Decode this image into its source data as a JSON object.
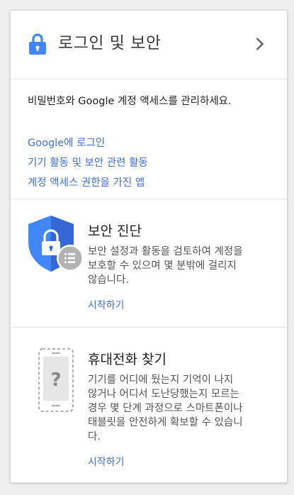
{
  "header": {
    "title": "로그인 및 보안"
  },
  "intro": {
    "description": "비밀번호와 Google 계정 액세스를 관리하세요.",
    "links": [
      "Google에 로그인",
      "기기 활동 및 보안 관련 활동",
      "계정 액세스 권한을 가진 앱"
    ]
  },
  "security_checkup": {
    "title": "보안 진단",
    "body_lines": [
      "보안 설정과 활동을 검토하여 계정을",
      "보호할 수 있으며 몇 분밖에 걸리지",
      "않습니다."
    ],
    "action": "시작하기"
  },
  "find_phone": {
    "title": "휴대전화 찾기",
    "body_lines": [
      "기기를 어디에 뒀는지 기억이 나지",
      "않거나 어디서 도난당했는지 모르는",
      "경우 몇 단계 과정으로 스마트폰이나",
      "태블릿을 안전하게 확보할 수 있습니",
      "다."
    ],
    "action": "시작하기"
  },
  "icons": {
    "lock": "lock-icon",
    "chevron": "chevron-right-icon",
    "shield": "shield-lock-icon",
    "checklist": "checklist-icon",
    "phone": "phone-question-icon"
  },
  "colors": {
    "accent_blue": "#4285f4",
    "link_blue": "#3f6fd9",
    "shield_dark": "#3367d6",
    "badge_gray": "#b3b3b3"
  }
}
